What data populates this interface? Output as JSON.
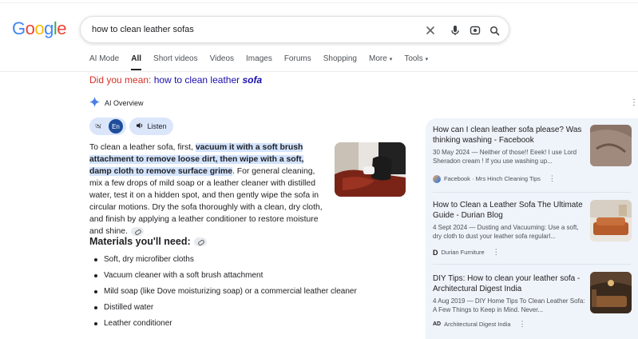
{
  "logo": {
    "letters": [
      "G",
      "o",
      "o",
      "g",
      "l",
      "e"
    ],
    "colors": [
      "#4285f4",
      "#ea4335",
      "#fbbc05",
      "#4285f4",
      "#34a853",
      "#ea4335"
    ]
  },
  "search": {
    "query": "how to clean leather sofas"
  },
  "tabs": [
    {
      "label": "AI Mode",
      "active": false
    },
    {
      "label": "All",
      "active": true
    },
    {
      "label": "Short videos",
      "active": false
    },
    {
      "label": "Videos",
      "active": false
    },
    {
      "label": "Images",
      "active": false
    },
    {
      "label": "Forums",
      "active": false
    },
    {
      "label": "Shopping",
      "active": false
    },
    {
      "label": "More",
      "active": false,
      "dropdown": true
    },
    {
      "label": "Tools",
      "active": false,
      "dropdown": true
    }
  ],
  "did_you_mean": {
    "prefix": "Did you mean:",
    "plain": "how to clean leather ",
    "emphasis": "sofa"
  },
  "ai_overview": {
    "title": "AI Overview",
    "language": "En",
    "listen": "Listen",
    "paragraph": {
      "p1": "To clean a leather sofa, first, ",
      "h1": "vacuum it with a soft brush attachment to remove loose dirt, then wipe with a soft, damp cloth to remove surface grime",
      "p2": ". For general cleaning, mix a few drops of mild soap or a leather cleaner with distilled water, test it on a hidden spot, and then gently wipe the sofa in circular motions. Dry the sofa thoroughly with a clean, dry cloth, and finish by applying a leather conditioner to restore moisture and shine."
    },
    "materials_heading": "Materials you'll need:",
    "materials": [
      "Soft, dry microfiber cloths",
      "Vacuum cleaner with a soft brush attachment",
      "Mild soap (like Dove moisturizing soap) or a commercial leather cleaner",
      "Distilled water",
      "Leather conditioner"
    ]
  },
  "sources": [
    {
      "title": "How can I clean leather sofa please? Was thinking washing - Facebook",
      "snippet": "30 May 2024 — Neither of those!! Eeek! I use Lord Sheradon cream ! If you use washing up...",
      "source": "Facebook · Mrs Hinch Cleaning Tips"
    },
    {
      "title": "How to Clean a Leather Sofa The Ultimate Guide - Durian Blog",
      "snippet": "4 Sept 2024 — Dusting and Vacuuming: Use a soft, dry cloth to dust your leather sofa regularl...",
      "source": "Durian Furniture"
    },
    {
      "title": "DIY Tips: How to clean your leather sofa - Architectural Digest India",
      "snippet": "4 Aug 2019 — DIY Home Tips To Clean Leather Sofa: A Few Things to Keep in Mind. Never...",
      "source": "Architectural Digest India"
    }
  ]
}
